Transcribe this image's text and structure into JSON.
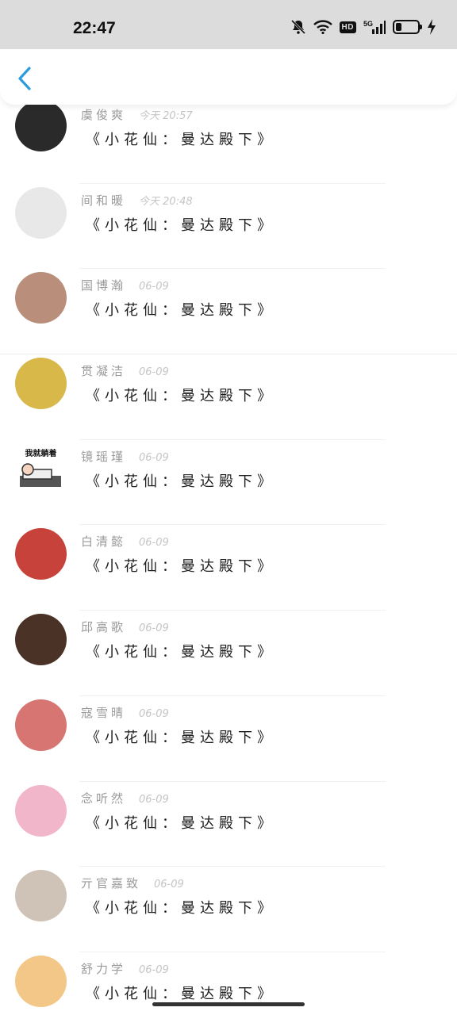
{
  "status_bar": {
    "time": "22:47",
    "hd": "HD",
    "network": "5G",
    "battery_level": 0.25,
    "icons": [
      "mute-bell-icon",
      "wifi-icon",
      "hd-icon",
      "signal-5g-icon",
      "battery-icon",
      "charging-icon"
    ]
  },
  "header": {
    "back_icon": "chevron-left-icon",
    "accent": "#2d9cdb"
  },
  "items": [
    {
      "name": "虞俊爽",
      "time": "今天 20:57",
      "message": "《小花仙：曼达殿下》",
      "avatar": "#2a2a2a"
    },
    {
      "name": "间和暖",
      "time": "今天 20:48",
      "message": "《小花仙：曼达殿下》",
      "avatar": "#e8e8e8"
    },
    {
      "name": "国博瀚",
      "time": "06-09",
      "message": "《小花仙：曼达殿下》",
      "avatar": "#b98f7c"
    },
    {
      "name": "贯凝洁",
      "time": "06-09",
      "message": "《小花仙：曼达殿下》",
      "avatar": "#d9b84a"
    },
    {
      "name": "镜瑶瑾",
      "time": "06-09",
      "message": "《小花仙：曼达殿下》",
      "avatar": "#ffffff",
      "avatar_caption": "我就躺着"
    },
    {
      "name": "白清懿",
      "time": "06-09",
      "message": "《小花仙：曼达殿下》",
      "avatar": "#c6423a"
    },
    {
      "name": "邱高歌",
      "time": "06-09",
      "message": "《小花仙：曼达殿下》",
      "avatar": "#4a3326"
    },
    {
      "name": "寇雪晴",
      "time": "06-09",
      "message": "《小花仙：曼达殿下》",
      "avatar": "#d77572"
    },
    {
      "name": "念听然",
      "time": "06-09",
      "message": "《小花仙：曼达殿下》",
      "avatar": "#f2b6cb"
    },
    {
      "name": "亓官嘉致",
      "time": "06-09",
      "message": "《小花仙：曼达殿下》",
      "avatar": "#cfc2b6"
    },
    {
      "name": "舒力学",
      "time": "06-09",
      "message": "《小花仙：曼达殿下》",
      "avatar": "#f3c788"
    }
  ]
}
